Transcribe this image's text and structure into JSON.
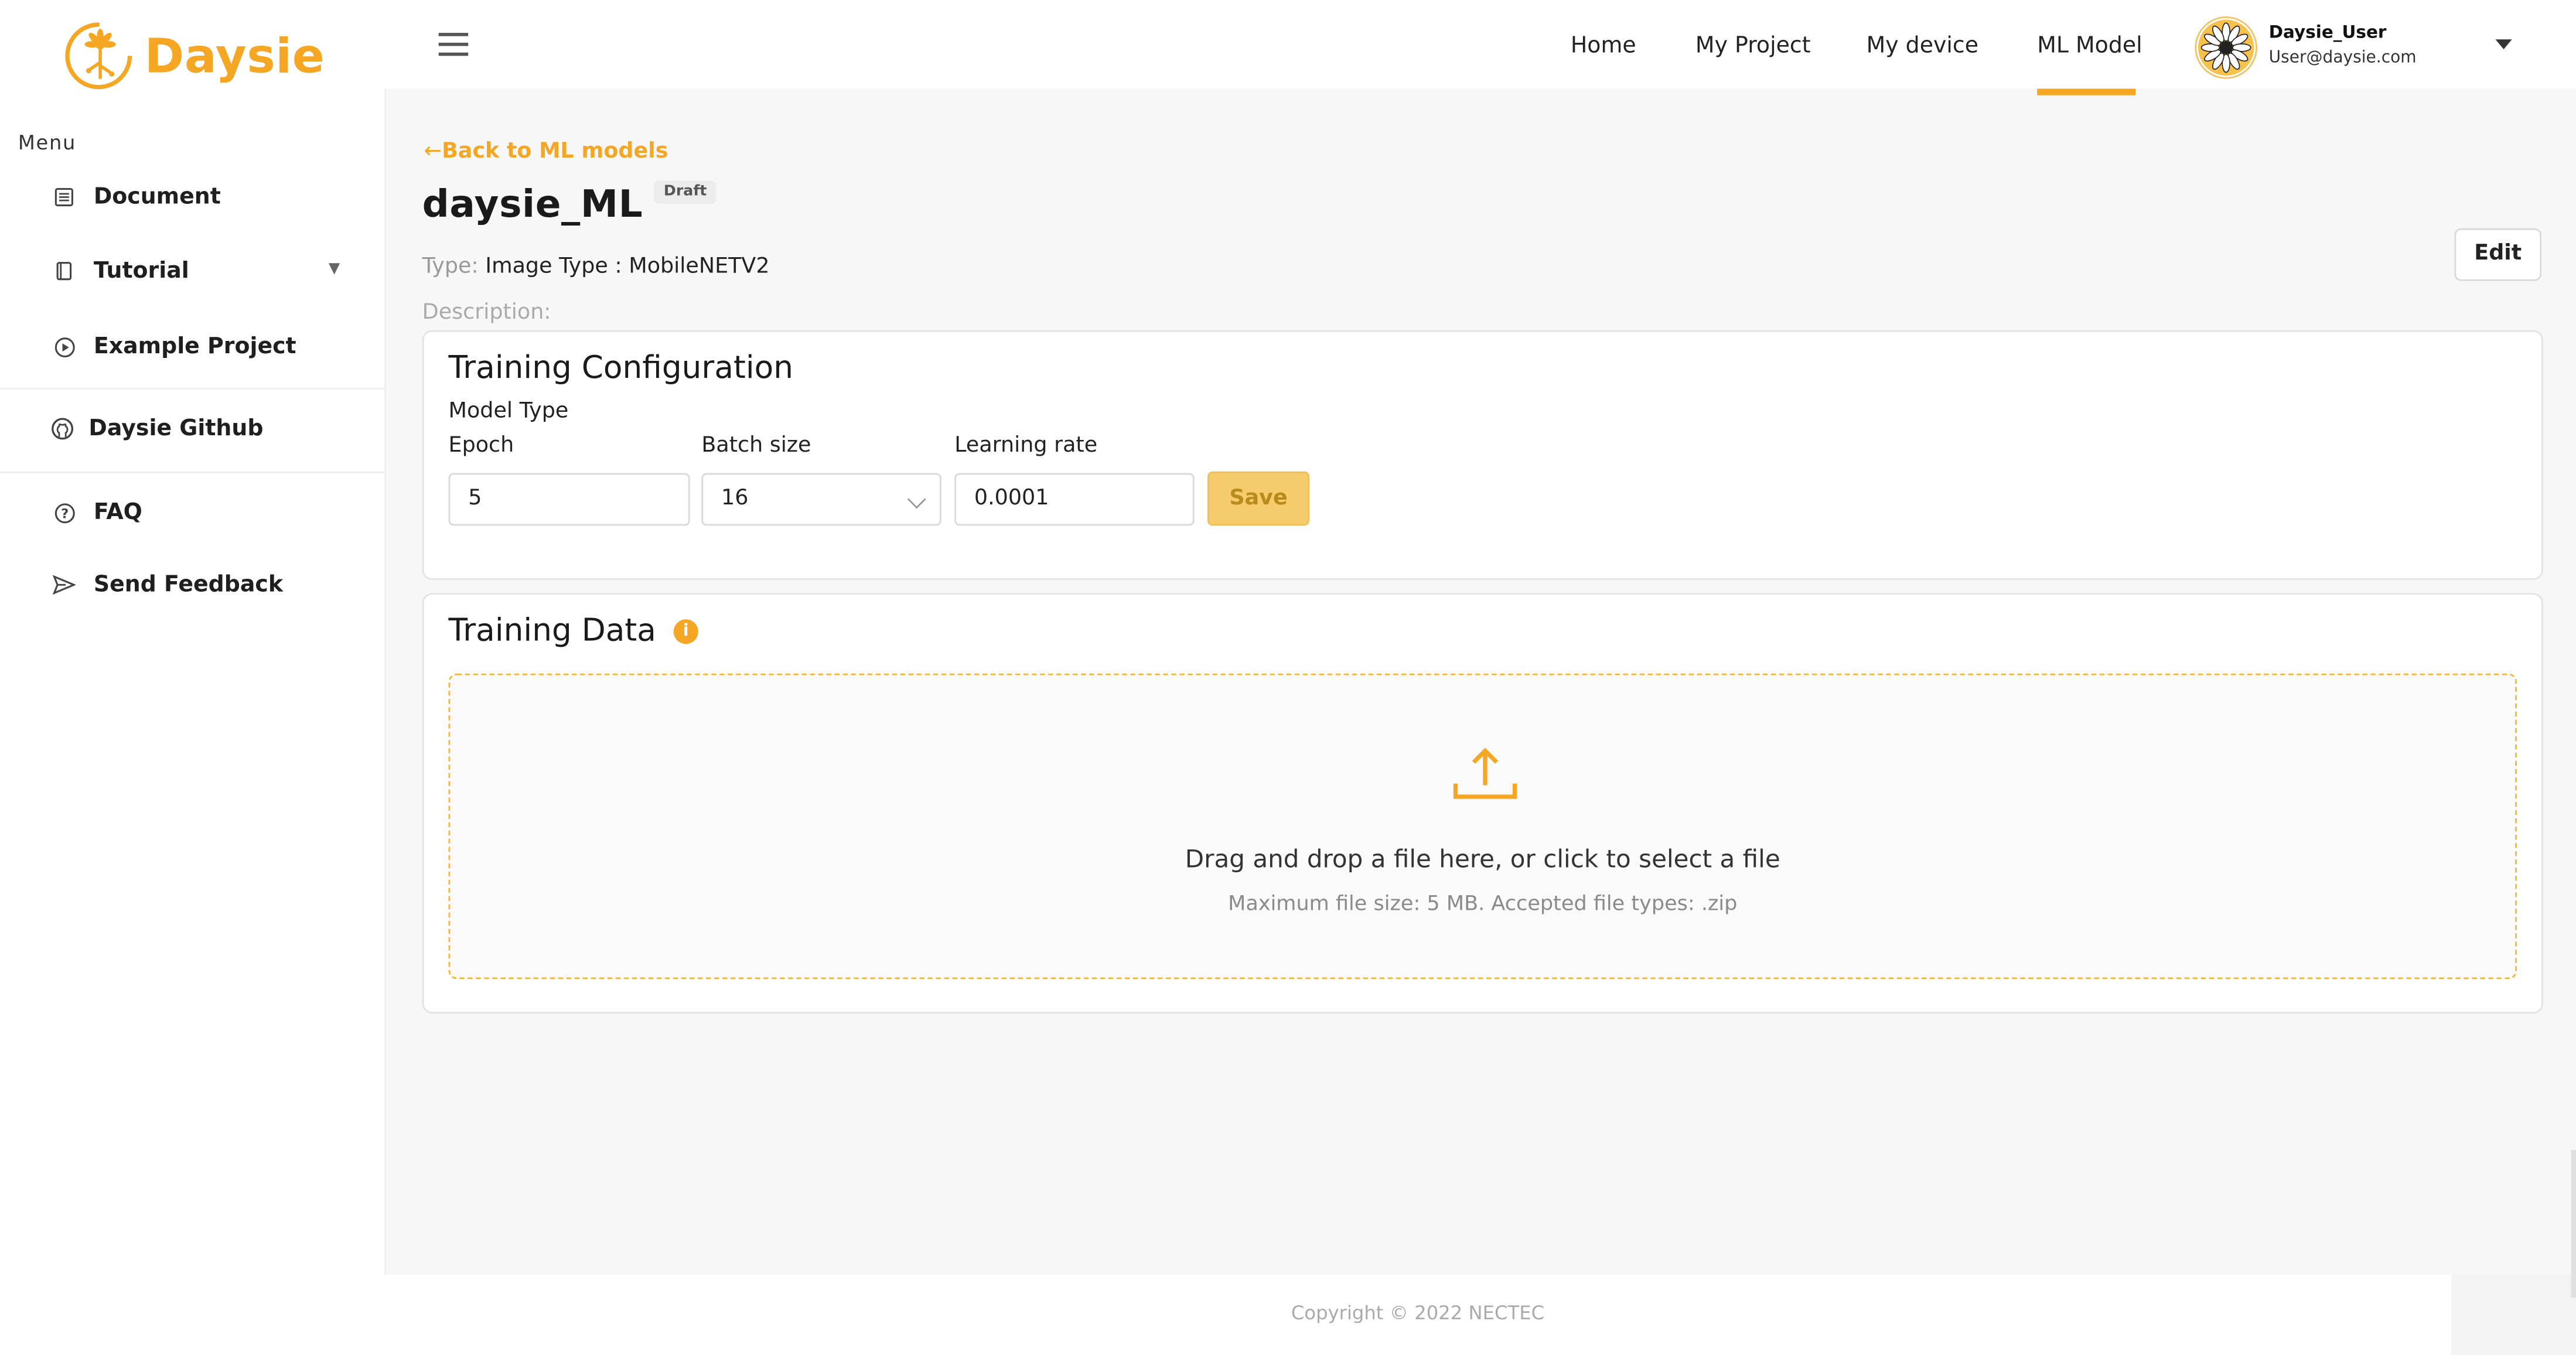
{
  "brand": {
    "name": "Daysie",
    "color": "#f5a623"
  },
  "sidebar": {
    "menu_title": "Menu",
    "items": [
      {
        "label": "Document",
        "icon": "document-icon"
      },
      {
        "label": "Tutorial",
        "icon": "book-icon",
        "has_dropdown": true
      },
      {
        "label": "Example Project",
        "icon": "play-circle-icon"
      },
      {
        "label": "Daysie Github",
        "icon": "github-icon"
      },
      {
        "label": "FAQ",
        "icon": "question-circle-icon"
      },
      {
        "label": "Send Feedback",
        "icon": "send-icon"
      }
    ]
  },
  "topbar": {
    "nav": [
      "Home",
      "My Project",
      "My device",
      "ML Model"
    ],
    "active_nav": "ML Model",
    "user": {
      "name": "Daysie_User",
      "email": "User@daysie.com"
    }
  },
  "page": {
    "back_label": "Back to ML models",
    "title": "daysie_ML",
    "status_badge": "Draft",
    "type_label": "Type:",
    "type_value": "Image Type : MobileNETV2",
    "description_label": "Description:",
    "edit_label": "Edit"
  },
  "training_config": {
    "title": "Training Configuration",
    "model_type_label": "Model Type",
    "epoch_label": "Epoch",
    "epoch_value": "5",
    "batch_label": "Batch size",
    "batch_value": "16",
    "lr_label": "Learning rate",
    "lr_value": "0.0001",
    "save_label": "Save"
  },
  "training_data": {
    "title": "Training Data",
    "info_glyph": "i",
    "dropzone_text": "Drag and drop a file here, or click to select a file",
    "dropzone_hint": "Maximum file size: 5 MB. Accepted file types: .zip"
  },
  "footer": {
    "copyright": "Copyright © 2022 NECTEC"
  }
}
